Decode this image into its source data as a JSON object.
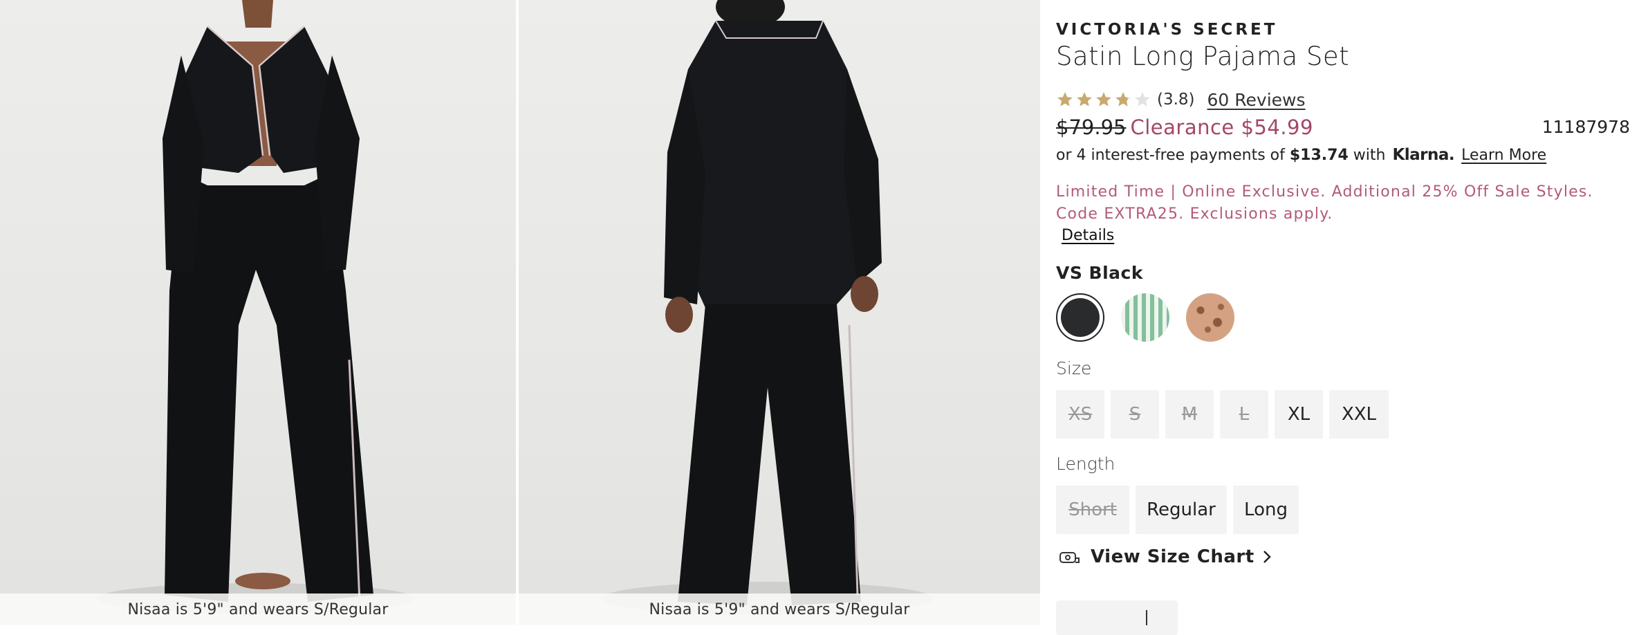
{
  "gallery": {
    "images": [
      {
        "caption": "Nisaa is 5'9\" and wears S/Regular",
        "view": "front"
      },
      {
        "caption": "Nisaa is 5'9\" and wears S/Regular",
        "view": "back"
      }
    ]
  },
  "product": {
    "brand": "VICTORIA'S SECRET",
    "title": "Satin Long Pajama Set",
    "rating": {
      "value": 3.8,
      "display": "(3.8)",
      "stars_total": 5
    },
    "reviews_label": "60 Reviews",
    "price_original": "$79.95",
    "price_sale": "Clearance $54.99",
    "sku": "11187978",
    "klarna": {
      "prefix": "or 4 interest-free payments of ",
      "amount": "$13.74",
      "middle": " with",
      "logo": "Klarna.",
      "learn_more": "Learn More"
    },
    "promo": "Limited Time | Online Exclusive. Additional 25% Off Sale Styles. Code EXTRA25. Exclusions apply.",
    "details_link": "Details",
    "color": {
      "selected_label": "VS Black",
      "swatches": [
        {
          "name": "VS Black",
          "color": "#2a2b2d",
          "selected": true
        },
        {
          "name": "Green Stripe",
          "color": "#8fc3a6",
          "selected": false
        },
        {
          "name": "Leopard",
          "color": "#c98a6a",
          "selected": false
        }
      ]
    },
    "size": {
      "label": "Size",
      "options": [
        {
          "label": "XS",
          "available": false
        },
        {
          "label": "S",
          "available": false
        },
        {
          "label": "M",
          "available": false
        },
        {
          "label": "L",
          "available": false
        },
        {
          "label": "XL",
          "available": true
        },
        {
          "label": "XXL",
          "available": true
        }
      ]
    },
    "length": {
      "label": "Length",
      "options": [
        {
          "label": "Short",
          "available": false
        },
        {
          "label": "Regular",
          "available": true
        },
        {
          "label": "Long",
          "available": true
        }
      ]
    },
    "size_chart_label": "View Size Chart"
  },
  "colors": {
    "accent": "#a4456a",
    "promo": "#b25a79",
    "star": "#c9a96e",
    "option_bg": "#f3f3f3"
  }
}
